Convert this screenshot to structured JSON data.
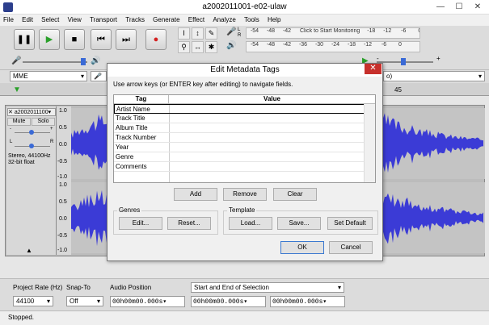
{
  "window": {
    "title": "a2002011001-e02-ulaw"
  },
  "menu": [
    "File",
    "Edit",
    "Select",
    "View",
    "Transport",
    "Tracks",
    "Generate",
    "Effect",
    "Analyze",
    "Tools",
    "Help"
  ],
  "meters": {
    "record_ticks": [
      "-54",
      "-48",
      "-42"
    ],
    "record_prompt": "Click to Start Monitoring",
    "record_ticks_right": [
      "-18",
      "-12",
      "-6",
      "0"
    ],
    "play_ticks": [
      "-54",
      "-48",
      "-42",
      "-36",
      "-30",
      "-24",
      "-18",
      "-12",
      "-6",
      "0"
    ]
  },
  "mixer": {
    "rec_l": "L",
    "rec_r": "R",
    "minus": "-",
    "plus": "+"
  },
  "device": {
    "host": "MME",
    "output_suffix": "o)"
  },
  "ruler": {
    "mark_45": "45"
  },
  "track": {
    "name": "a2002011100",
    "mute": "Mute",
    "solo": "Solo",
    "pan_l": "L",
    "pan_r": "R",
    "info_line1": "Stereo, 44100Hz",
    "info_line2": "32-bit float",
    "scale_top": "1.0",
    "scale_mid": "0.0",
    "scale_bottom": "-1.0",
    "scale_top2": "1.0",
    "scale_mid2": "0.0",
    "scale_bottom2": "-1.0",
    "scale_q1": "0.5",
    "scale_q3": "-0.5",
    "scale_q1b": "0.5",
    "scale_q3b": "-0.5"
  },
  "selection_bar": {
    "rate_label": "Project Rate (Hz)",
    "rate_value": "44100",
    "snap_label": "Snap-To",
    "snap_value": "Off",
    "audio_pos_label": "Audio Position",
    "selection_mode": "Start and End of Selection",
    "audio_pos_value": "00h00m00.000s",
    "sel_start": "00h00m00.000s",
    "sel_end": "00h00m00.000s"
  },
  "status": {
    "text": "Stopped."
  },
  "dialog": {
    "title": "Edit Metadata Tags",
    "close": "✕",
    "instructions": "Use arrow keys (or ENTER key after editing) to navigate fields.",
    "col_tag": "Tag",
    "col_value": "Value",
    "rows": [
      "Artist Name",
      "Track Title",
      "Album Title",
      "Track Number",
      "Year",
      "Genre",
      "Comments"
    ],
    "add": "Add",
    "remove": "Remove",
    "clear": "Clear",
    "genres_label": "Genres",
    "edit": "Edit...",
    "reset": "Reset...",
    "template_label": "Template",
    "load": "Load...",
    "save": "Save...",
    "set_default": "Set Default",
    "ok": "OK",
    "cancel": "Cancel"
  },
  "colors": {
    "waveform": "#3b3bd6",
    "record": "#d42020",
    "play": "#2aa02a",
    "dialog_close": "#c7302c"
  }
}
